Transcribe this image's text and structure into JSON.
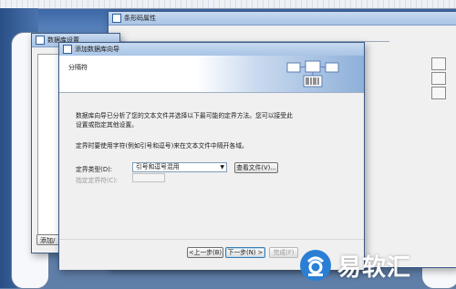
{
  "windows": {
    "barcode_props": {
      "title": "条形码属性"
    },
    "db_settings": {
      "title": "数据库设置",
      "add_button": "添加/"
    },
    "wizard": {
      "title": "添加数据库向导",
      "header_title": "分隔符",
      "desc": "数据库向导已分析了您的文本文件并选择以下最可能的定界方法。您可以接受此设置或指定其他设置。",
      "hint": "定界时要使用字符(例如引号和逗号)来在文本文件中隔开各域。",
      "delimiter_type_label": "定界类型(D):",
      "delimiter_type_value": "引号和逗号混用",
      "view_file_button": "查看文件(V)...",
      "specify_delimiter_label": "指定定界符(C):",
      "back_button": "<上一步(B)",
      "next_button": "下一步(N) >",
      "finish_button": "完成(F)"
    }
  },
  "watermark": {
    "text": "易软汇"
  },
  "colors": {
    "accent": "#3c7fb1",
    "desktop": "#5f7ea8",
    "watermark_logo": "#2a7fd4"
  }
}
